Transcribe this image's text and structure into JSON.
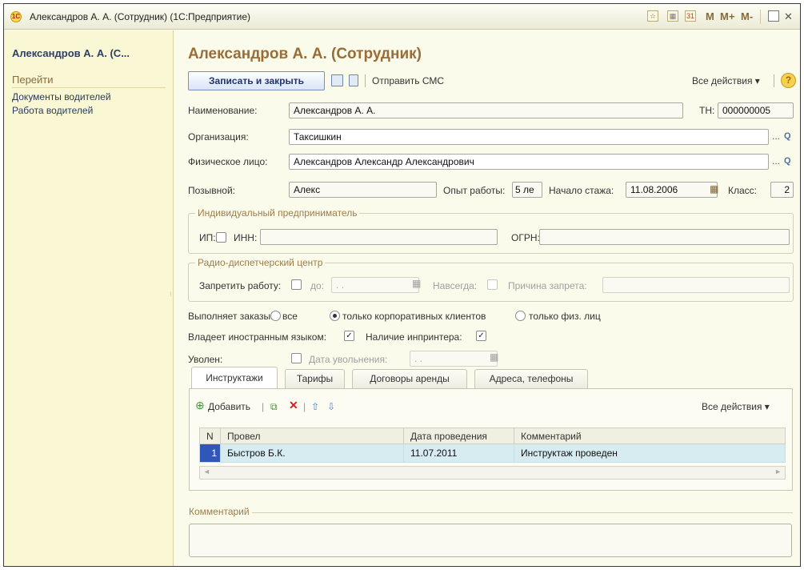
{
  "window": {
    "title": "Александров А. А. (Сотрудник) (1С:Предприятие)",
    "logo": "1С"
  },
  "titlebar_buttons": {
    "m": "M",
    "m_plus": "M+",
    "m_minus": "M-"
  },
  "sidebar": {
    "title": "Александров А. А. (С...",
    "section": "Перейти",
    "items": [
      {
        "label": "Документы водителей"
      },
      {
        "label": "Работа водителей"
      }
    ]
  },
  "page": {
    "title": "Александров А. А. (Сотрудник)"
  },
  "toolbar": {
    "save_close": "Записать и закрыть",
    "send_sms": "Отправить СМС",
    "all_actions": "Все действия ▾",
    "help": "?"
  },
  "form": {
    "name_label": "Наименование:",
    "name_value": "Александров А. А.",
    "tn_label": "ТН:",
    "tn_value": "000000005",
    "org_label": "Организация:",
    "org_value": "Таксишкин",
    "person_label": "Физическое лицо:",
    "person_value": "Александров Александр Александрович",
    "callsign_label": "Позывной:",
    "callsign_value": "Алекс",
    "experience_label": "Опыт работы:",
    "experience_value": "5 ле",
    "start_label": "Начало стажа:",
    "start_value": "11.08.2006",
    "class_label": "Класс:",
    "class_value": "2",
    "ip_group": "Индивидуальный предприниматель",
    "ip_label": "ИП:",
    "inn_label": "ИНН:",
    "ogrn_label": "ОГРН:",
    "radio_group": "Радио-диспетчерский центр",
    "forbid_label": "Запретить работу:",
    "until_label": "до:",
    "until_placeholder": ". .",
    "forever_label": "Навсегда:",
    "reason_label": "Причина запрета:",
    "orders_label": "Выполняет заказы:",
    "orders_options": [
      "все",
      "только корпоративных клиентов",
      "только физ. лиц"
    ],
    "orders_selected": "только корпоративных клиентов",
    "foreign_label": "Владеет иностранным языком:",
    "printer_label": "Наличие инпринтера:",
    "fired_label": "Уволен:",
    "fired_date_label": "Дата увольнения:",
    "fired_date_placeholder": ". .",
    "comment_label": "Комментарий"
  },
  "checks": {
    "ip": false,
    "forbid": false,
    "forever": false,
    "foreign": true,
    "printer": true,
    "fired": false
  },
  "tabs": [
    {
      "label": "Инструктажи"
    },
    {
      "label": "Тарифы"
    },
    {
      "label": "Договоры аренды"
    },
    {
      "label": "Адреса, телефоны"
    }
  ],
  "tab_toolbar": {
    "add": "Добавить",
    "all_actions": "Все действия ▾"
  },
  "table": {
    "columns": [
      "N",
      "Провел",
      "Дата проведения",
      "Комментарий"
    ],
    "rows": [
      {
        "n": "1",
        "by": "Быстров Б.К.",
        "date": "11.07.2011",
        "comment": "Инструктаж проведен"
      }
    ]
  }
}
